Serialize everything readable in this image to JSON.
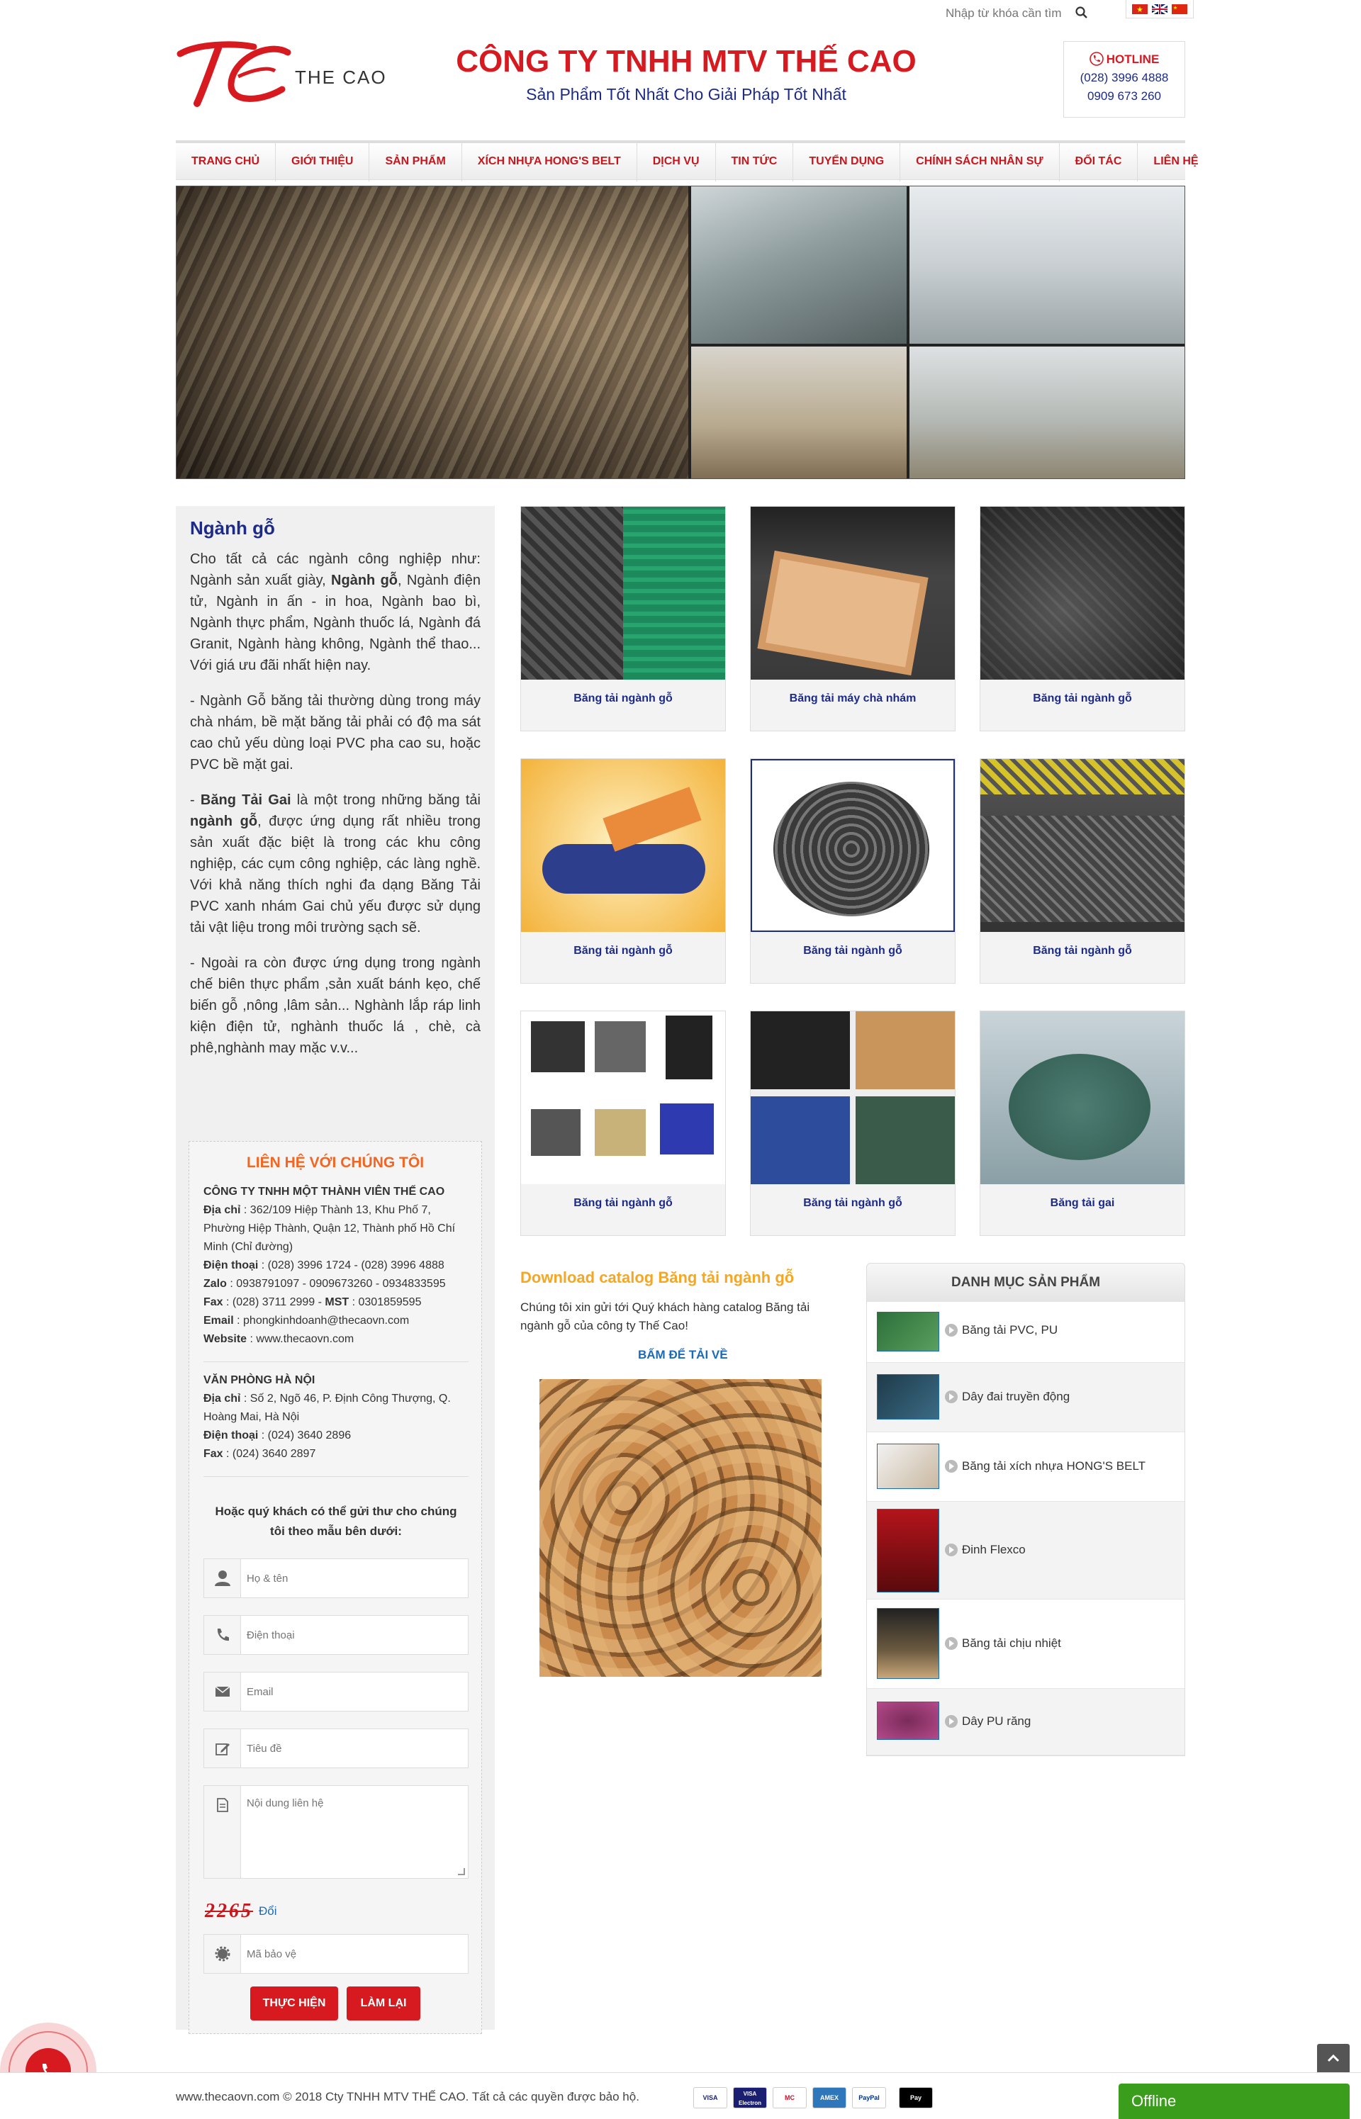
{
  "topbar": {
    "search_placeholder": "Nhập từ khóa cần tìm"
  },
  "header": {
    "logo_text": "THE CAO",
    "company": "CÔNG TY TNHH MTV THẾ CAO",
    "slogan": "Sản Phẩm Tốt Nhất Cho Giải Pháp Tốt Nhất",
    "hotline_title": "HOTLINE",
    "hotline_1": "(028) 3996 4888",
    "hotline_2": "0909 673 260"
  },
  "nav": [
    "TRANG CHỦ",
    "GIỚI THIỆU",
    "SẢN PHẨM",
    "XÍCH NHỰA HONG'S BELT",
    "DỊCH VỤ",
    "TIN TỨC",
    "TUYỂN DỤNG",
    "CHÍNH SÁCH NHÂN SỰ",
    "ĐỐI TÁC",
    "LIÊN HỆ"
  ],
  "sidebar": {
    "title": "Ngành gỗ",
    "p1_a": "Cho tất cả các ngành công nghiệp như: Ngành sản xuất giày, ",
    "p1_b": "Ngành gỗ",
    "p1_c": ", Ngành điện tử, Ngành in ấn - in hoa, Ngành bao bì, Ngành thực phẩm, Ngành thuốc lá, Ngành đá Granit, Ngành hàng không, Ngành thể thao... Với giá ưu đãi nhất hiện nay.",
    "p2": "- Ngành Gỗ băng tải thường dùng trong máy chà nhám, bề mặt băng tải phải có độ ma sát cao chủ yếu dùng loại PVC pha cao su, hoặc PVC bề mặt gai.",
    "p3_a": "- ",
    "p3_b": "Băng Tải Gai",
    "p3_c": " là một trong những băng tải ",
    "p3_d": "ngành gỗ",
    "p3_e": ", được ứng dụng rất nhiều trong sản xuất đặc biệt là trong các khu công nghiệp, các cụm công nghiệp, các làng nghề. Với khả năng thích nghi đa dạng Băng Tải PVC xanh nhám Gai chủ yếu được sử dụng tải vật liệu trong môi trường sạch sẽ.",
    "p4": "- Ngoài ra còn được ứng dụng trong ngành chế biên thực phẩm ,sản xuất bánh kẹo, chế biến gỗ ,nông ,lâm sản... Nghành lắp ráp linh kiện điện tử, nghành thuốc lá , chè, cà phê,nghành may mặc v.v..."
  },
  "contact": {
    "title": "LIÊN HỆ VỚI CHÚNG TÔI",
    "company": "CÔNG TY TNHH MỘT THÀNH VIÊN THẾ CAO",
    "addr_label": "Địa chỉ",
    "addr": " : 362/109 Hiệp Thành 13, Khu Phố 7, Phường Hiệp Thành, Quận 12, Thành phố Hồ Chí Minh (Chỉ đường)",
    "phone_label": "Điện thoại",
    "phone": " : (028) 3996 1724  -  (028) 3996 4888",
    "zalo_label": "Zalo",
    "zalo": " : 0938791097 - 0909673260 - 0934833595",
    "fax_label": "Fax",
    "fax": " : (028) 3711 2999  -  ",
    "mst_label": "MST",
    "mst": " : 0301859595",
    "email_label": "Email",
    "email": " : phongkinhdoanh@thecaovn.com",
    "web_label": "Website",
    "web": " : www.thecaovn.com",
    "hn_title": "VĂN PHÒNG HÀ NỘI",
    "hn_addr_label": "Địa chỉ",
    "hn_addr": " : Số 2, Ngõ 46, P. Định Công Thượng, Q. Hoàng Mai, Hà Nội",
    "hn_phone_label": "Điện thoại",
    "hn_phone": " : (024) 3640 2896",
    "hn_fax_label": "Fax",
    "hn_fax": " : (024) 3640 2897",
    "form_intro": "Hoặc quý khách có thể gửi thư cho chúng tôi theo mẫu bên dưới:",
    "ph_name": "Họ & tên",
    "ph_phone": "Điện thoại",
    "ph_email": "Email",
    "ph_subject": "Tiêu đề",
    "ph_message": "Nội dung liên hệ",
    "captcha": "2265",
    "captcha_refresh": "Đổi",
    "ph_captcha": "Mã bảo vệ",
    "submit": "THỰC HIỆN",
    "reset": "LÀM LẠI"
  },
  "products": [
    {
      "label": "Băng tải ngành gỗ"
    },
    {
      "label": "Băng tải máy chà nhám"
    },
    {
      "label": "Băng tải ngành gỗ"
    },
    {
      "label": "Băng tải ngành gỗ"
    },
    {
      "label": "Băng tải ngành gỗ"
    },
    {
      "label": "Băng tải ngành gỗ"
    },
    {
      "label": "Băng tải ngành gỗ"
    },
    {
      "label": "Băng tải ngành gỗ"
    },
    {
      "label": "Băng tải gai"
    }
  ],
  "catalog": {
    "title": "Download catalog Băng tải ngành gỗ",
    "text": "Chúng tôi xin gửi tới Quý khách hàng catalog Băng tải ngành gỗ của công ty Thế Cao!",
    "download": "BẤM ĐỂ TẢI VỀ"
  },
  "categories": {
    "title": "DANH MỤC SẢN PHẨM",
    "items": [
      "Băng tải PVC, PU",
      "Dây đai truyền động",
      "Băng tải xích nhựa HONG'S BELT",
      "Đinh Flexco",
      "Băng tải chịu nhiệt",
      "Dây PU răng"
    ]
  },
  "footer": {
    "text": "www.thecaovn.com © 2018 Cty TNHH MTV THẾ CAO. Tất cả các quyền được bảo hộ.",
    "cards": [
      "VISA",
      "VISA Electron",
      "MC",
      "AMEX",
      "PayPal",
      "Pay"
    ],
    "offline": "Offline"
  },
  "colors": {
    "brand_red": "#d71920",
    "brand_blue": "#1c2b8a",
    "accent_orange": "#f26522",
    "offline_green": "#3a9d1b"
  }
}
